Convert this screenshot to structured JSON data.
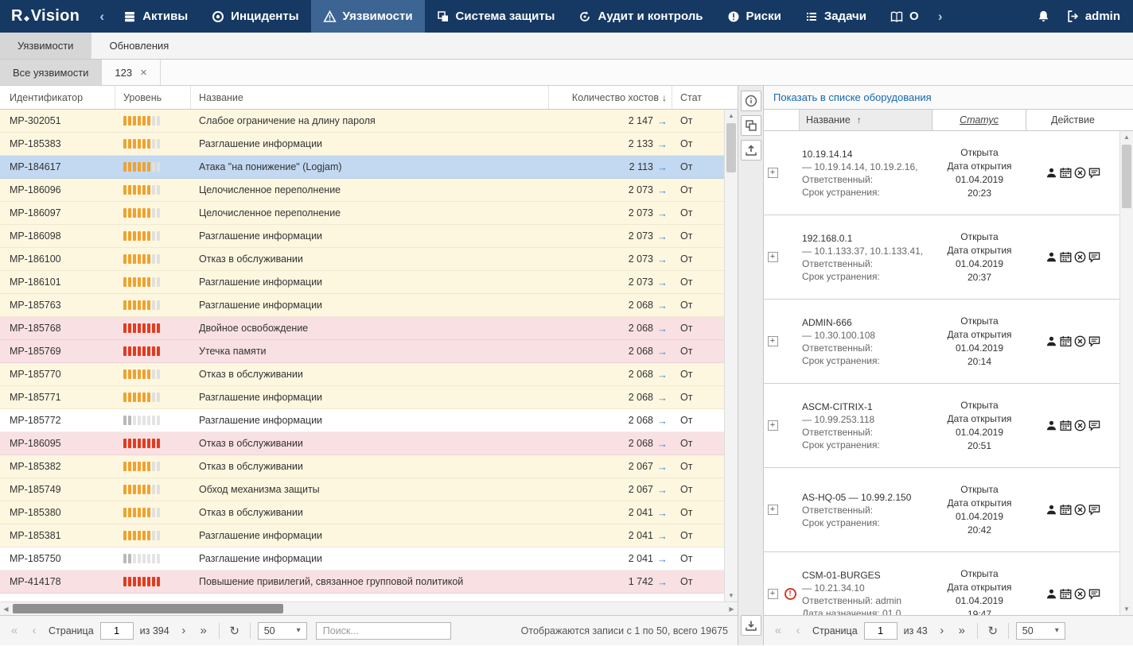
{
  "logo": {
    "r": "R",
    "rest": "Vision"
  },
  "icons": {
    "goto_arrow": "→",
    "plus": "+",
    "sort_desc": "↓",
    "sort_asc": "↑",
    "caret": "▾",
    "refresh": "↻",
    "first": "«",
    "prev": "‹",
    "next": "›",
    "last": "»",
    "close": "×",
    "overdue_mark": "!",
    "scroll_up": "▲",
    "scroll_down": "▼",
    "scroll_left": "◀",
    "scroll_right": "▶"
  },
  "navbar": {
    "scroll_left": "‹",
    "scroll_right": "›",
    "items": [
      {
        "label": "Активы"
      },
      {
        "label": "Инциденты"
      },
      {
        "label": "Уязвимости"
      },
      {
        "label": "Система защиты"
      },
      {
        "label": "Аудит и контроль"
      },
      {
        "label": "Риски"
      },
      {
        "label": "Задачи"
      },
      {
        "label": "О"
      }
    ],
    "user_label": "admin"
  },
  "page_tabs": [
    {
      "label": "Уязвимости"
    },
    {
      "label": "Обновления"
    }
  ],
  "filter_tabs": [
    {
      "label": "Все уязвимости"
    },
    {
      "label": "123"
    }
  ],
  "vuln_table": {
    "columns": {
      "id": "Идентификатор",
      "level": "Уровень",
      "name": "Название",
      "hosts": "Количество хостов",
      "status": "Стат"
    },
    "severity_levels": {
      "high": {
        "color": "#f0a22e",
        "empty_color": "#e0e0e0",
        "filled": 6,
        "total": 8
      },
      "critical": {
        "color": "#e23b1f",
        "empty_color": "#e0e0e0",
        "filled": 8,
        "total": 8
      },
      "low": {
        "color": "#b9b9b9",
        "empty_color": "#e4e4e4",
        "filled": 2,
        "total": 8
      }
    },
    "rows": [
      {
        "id": "MP-302051",
        "severity": "high",
        "name": "Слабое ограничение на длину пароля",
        "hosts": "2 147",
        "status": "От"
      },
      {
        "id": "MP-185383",
        "severity": "high",
        "name": "Разглашение информации",
        "hosts": "2 133",
        "status": "От"
      },
      {
        "id": "MP-184617",
        "severity": "high",
        "name": "Атака \"на понижение\" (Logjam)",
        "hosts": "2 113",
        "status": "От",
        "selected": true
      },
      {
        "id": "MP-186096",
        "severity": "high",
        "name": "Целочисленное переполнение",
        "hosts": "2 073",
        "status": "От"
      },
      {
        "id": "MP-186097",
        "severity": "high",
        "name": "Целочисленное переполнение",
        "hosts": "2 073",
        "status": "От"
      },
      {
        "id": "MP-186098",
        "severity": "high",
        "name": "Разглашение информации",
        "hosts": "2 073",
        "status": "От"
      },
      {
        "id": "MP-186100",
        "severity": "high",
        "name": "Отказ в обслуживании",
        "hosts": "2 073",
        "status": "От"
      },
      {
        "id": "MP-186101",
        "severity": "high",
        "name": "Разглашение информации",
        "hosts": "2 073",
        "status": "От"
      },
      {
        "id": "MP-185763",
        "severity": "high",
        "name": "Разглашение информации",
        "hosts": "2 068",
        "status": "От"
      },
      {
        "id": "MP-185768",
        "severity": "critical",
        "name": "Двойное освобождение",
        "hosts": "2 068",
        "status": "От"
      },
      {
        "id": "MP-185769",
        "severity": "critical",
        "name": "Утечка памяти",
        "hosts": "2 068",
        "status": "От"
      },
      {
        "id": "MP-185770",
        "severity": "high",
        "name": "Отказ в обслуживании",
        "hosts": "2 068",
        "status": "От"
      },
      {
        "id": "MP-185771",
        "severity": "high",
        "name": "Разглашение информации",
        "hosts": "2 068",
        "status": "От"
      },
      {
        "id": "MP-185772",
        "severity": "low",
        "name": "Разглашение информации",
        "hosts": "2 068",
        "status": "От"
      },
      {
        "id": "MP-186095",
        "severity": "critical",
        "name": "Отказ в обслуживании",
        "hosts": "2 068",
        "status": "От"
      },
      {
        "id": "MP-185382",
        "severity": "high",
        "name": "Отказ в обслуживании",
        "hosts": "2 067",
        "status": "От"
      },
      {
        "id": "MP-185749",
        "severity": "high",
        "name": "Обход механизма защиты",
        "hosts": "2 067",
        "status": "От"
      },
      {
        "id": "MP-185380",
        "severity": "high",
        "name": "Отказ в обслуживании",
        "hosts": "2 041",
        "status": "От"
      },
      {
        "id": "MP-185381",
        "severity": "high",
        "name": "Разглашение информации",
        "hosts": "2 041",
        "status": "От"
      },
      {
        "id": "MP-185750",
        "severity": "low",
        "name": "Разглашение информации",
        "hosts": "2 041",
        "status": "От"
      },
      {
        "id": "MP-414178",
        "severity": "critical",
        "name": "Повышение привилегий, связанное групповой политикой",
        "hosts": "1 742",
        "status": "От"
      }
    ]
  },
  "left_pager": {
    "page_label": "Страница",
    "page_value": "1",
    "total_label": "из 394",
    "page_size": "50",
    "search_placeholder": "Поиск...",
    "summary": "Отображаются записи с 1 по 50, всего 19675"
  },
  "equipment_panel": {
    "link": "Показать в списке оборудования",
    "columns": {
      "name": "Название",
      "status": "Статус",
      "action": "Действие"
    },
    "rows": [
      {
        "name": "10.19.14.14",
        "ips": "— 10.19.14.14, 10.19.2.16,",
        "line3": "Ответственный:",
        "line4": "Срок устранения:",
        "status": "Открыта",
        "status_label": "Дата открытия",
        "date": "01.04.2019",
        "time": "20:23"
      },
      {
        "name": "192.168.0.1",
        "ips": "— 10.1.133.37, 10.1.133.41,",
        "line3": "Ответственный:",
        "line4": "Срок устранения:",
        "status": "Открыта",
        "status_label": "Дата открытия",
        "date": "01.04.2019",
        "time": "20:37"
      },
      {
        "name": "ADMIN-666",
        "ips": "— 10.30.100.108",
        "line3": "Ответственный:",
        "line4": "Срок устранения:",
        "status": "Открыта",
        "status_label": "Дата открытия",
        "date": "01.04.2019",
        "time": "20:14"
      },
      {
        "name": "ASCM-CITRIX-1",
        "ips": "— 10.99.253.118",
        "line3": "Ответственный:",
        "line4": "Срок устранения:",
        "status": "Открыта",
        "status_label": "Дата открытия",
        "date": "01.04.2019",
        "time": "20:51"
      },
      {
        "name": "AS-HQ-05 — 10.99.2.150",
        "ips": "",
        "line3": "Ответственный:",
        "line4": "Срок устранения:",
        "status": "Открыта",
        "status_label": "Дата открытия",
        "date": "01.04.2019",
        "time": "20:42"
      },
      {
        "name": "CSM-01-BURGES",
        "ips": "— 10.21.34.10",
        "line3": "Ответственный: admin",
        "line4": "Дата назначения: 01.0",
        "status": "Открыта",
        "status_label": "Дата открытия",
        "date": "01.04.2019",
        "time": "19:47",
        "warning": true
      }
    ],
    "pager": {
      "page_label": "Страница",
      "page_value": "1",
      "total_label": "из 43",
      "page_size": "50"
    }
  }
}
